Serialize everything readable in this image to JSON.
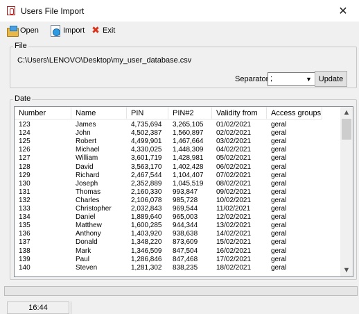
{
  "window": {
    "title": "Users File Import",
    "close_glyph": "✕"
  },
  "toolbar": {
    "open_label": "Open",
    "import_label": "Import",
    "exit_label": "Exit"
  },
  "file": {
    "group_title": "File",
    "path": "C:\\Users\\LENOVO\\Desktop\\my_user_database.csv",
    "separator_label": "Separator",
    "separator_value": ";",
    "update_label": "Update"
  },
  "date": {
    "group_title": "Date",
    "columns": [
      "Number",
      "Name",
      "PIN",
      "PIN#2",
      "Validity from",
      "Access groups"
    ],
    "rows": [
      [
        "123",
        "James",
        "4,735,694",
        "3,265,105",
        "01/02/2021",
        "geral"
      ],
      [
        "124",
        "John",
        "4,502,387",
        "1,560,897",
        "02/02/2021",
        "geral"
      ],
      [
        "125",
        "Robert",
        "4,499,901",
        "1,467,664",
        "03/02/2021",
        "geral"
      ],
      [
        "126",
        "Michael",
        "4,330,025",
        "1,448,309",
        "04/02/2021",
        "geral"
      ],
      [
        "127",
        "William",
        "3,601,719",
        "1,428,981",
        "05/02/2021",
        "geral"
      ],
      [
        "128",
        "David",
        "3,563,170",
        "1,402,428",
        "06/02/2021",
        "geral"
      ],
      [
        "129",
        "Richard",
        "2,467,544",
        "1,104,407",
        "07/02/2021",
        "geral"
      ],
      [
        "130",
        "Joseph",
        "2,352,889",
        "1,045,519",
        "08/02/2021",
        "geral"
      ],
      [
        "131",
        "Thomas",
        "2,160,330",
        "993,847",
        "09/02/2021",
        "geral"
      ],
      [
        "132",
        "Charles",
        "2,106,078",
        "985,728",
        "10/02/2021",
        "geral"
      ],
      [
        "133",
        "Christopher",
        "2,032,843",
        "969,544",
        "11/02/2021",
        "geral"
      ],
      [
        "134",
        "Daniel",
        "1,889,640",
        "965,003",
        "12/02/2021",
        "geral"
      ],
      [
        "135",
        "Matthew",
        "1,600,285",
        "944,344",
        "13/02/2021",
        "geral"
      ],
      [
        "136",
        "Anthony",
        "1,403,920",
        "938,638",
        "14/02/2021",
        "geral"
      ],
      [
        "137",
        "Donald",
        "1,348,220",
        "873,609",
        "15/02/2021",
        "geral"
      ],
      [
        "138",
        "Mark",
        "1,346,509",
        "847,504",
        "16/02/2021",
        "geral"
      ],
      [
        "139",
        "Paul",
        "1,286,846",
        "847,468",
        "17/02/2021",
        "geral"
      ],
      [
        "140",
        "Steven",
        "1,281,302",
        "838,235",
        "18/02/2021",
        "geral"
      ]
    ]
  },
  "status": {
    "time": "16:44"
  },
  "icons": {
    "app": "app-logo-icon",
    "open": "folder-open-icon",
    "import": "import-icon",
    "exit": "exit-x-icon",
    "dropdown": "chevron-down-icon",
    "scroll_up": "scroll-up-icon",
    "scroll_down": "scroll-down-icon"
  }
}
